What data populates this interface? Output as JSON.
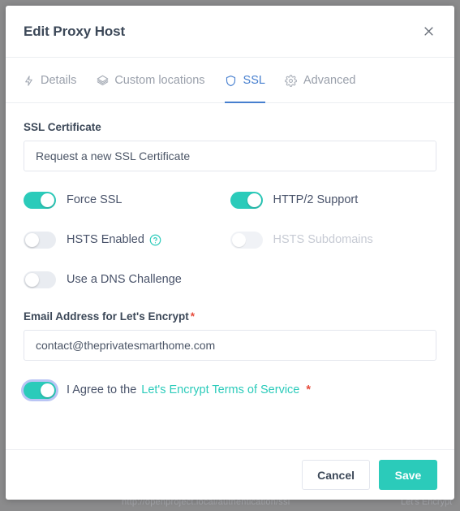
{
  "background": {
    "url_text": "http://openproject.local/authentication/ssl",
    "right_text": "Let's Encrypt"
  },
  "modal": {
    "title": "Edit Proxy Host",
    "close_icon": "close-icon",
    "tabs": [
      {
        "label": "Details",
        "icon": "bolt-icon",
        "active": false
      },
      {
        "label": "Custom locations",
        "icon": "layers-icon",
        "active": false
      },
      {
        "label": "SSL",
        "icon": "shield-icon",
        "active": true
      },
      {
        "label": "Advanced",
        "icon": "gear-icon",
        "active": false
      }
    ],
    "ssl_certificate": {
      "label": "SSL Certificate",
      "value": "Request a new SSL Certificate"
    },
    "toggles": [
      {
        "name": "force-ssl",
        "label": "Force SSL",
        "on": true,
        "disabled": false,
        "help": false
      },
      {
        "name": "http2-support",
        "label": "HTTP/2 Support",
        "on": true,
        "disabled": false,
        "help": false
      },
      {
        "name": "hsts-enabled",
        "label": "HSTS Enabled",
        "on": false,
        "disabled": false,
        "help": true
      },
      {
        "name": "hsts-subdomains",
        "label": "HSTS Subdomains",
        "on": false,
        "disabled": true,
        "help": false
      },
      {
        "name": "dns-challenge",
        "label": "Use a DNS Challenge",
        "on": false,
        "disabled": false,
        "help": false
      }
    ],
    "email": {
      "label": "Email Address for Let's Encrypt",
      "required_marker": "*",
      "value": "contact@theprivatesmarthome.com"
    },
    "terms": {
      "prefix": "I Agree to the",
      "link_text": "Let's Encrypt Terms of Service",
      "required_marker": "*",
      "on": true,
      "focused": true
    },
    "footer": {
      "cancel_label": "Cancel",
      "save_label": "Save"
    }
  },
  "colors": {
    "accent_teal": "#2bcbba",
    "tab_active_blue": "#467fcf",
    "required_red": "#e74c3c",
    "text_dark": "#3c4858"
  }
}
